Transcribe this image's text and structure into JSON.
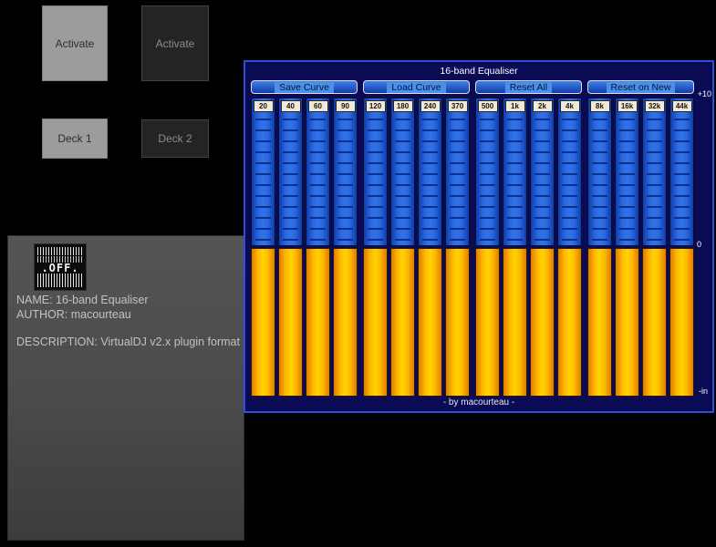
{
  "desktop": {
    "activate_button_1": "Activate",
    "activate_button_2": "Activate",
    "deck_1_button": "Deck 1",
    "deck_2_button": "Deck 2"
  },
  "plugin_info": {
    "icon_label": ".OFF.",
    "name_line": "NAME: 16-band Equaliser",
    "author_line": "AUTHOR: macourteau",
    "description_line": "DESCRIPTION: VirtualDJ v2.x plugin format"
  },
  "equalizer": {
    "title": "16-band Equaliser",
    "buttons": [
      "Save Curve",
      "Load Curve",
      "Reset All",
      "Reset on New"
    ],
    "bands": [
      "20",
      "40",
      "60",
      "90",
      "120",
      "180",
      "240",
      "370",
      "500",
      "1k",
      "2k",
      "4k",
      "8k",
      "16k",
      "32k",
      "44k"
    ],
    "band_gain_db": [
      0,
      0,
      0,
      0,
      0,
      0,
      0,
      0,
      0,
      0,
      0,
      0,
      0,
      0,
      0,
      0
    ],
    "scale": {
      "top": "+10",
      "mid": "0",
      "bottom": "-in"
    },
    "footer": "- by macourteau -",
    "colors": {
      "window_bg": "#0a0a55",
      "window_border": "#2b4fd6",
      "fader_blue": "#2a69e0",
      "fader_orange": "#ffc400",
      "button_face": "#2a62cf",
      "light_button": "#9c9c9c",
      "dark_button": "#242426",
      "panel_gray": "#4a4a4c"
    }
  }
}
